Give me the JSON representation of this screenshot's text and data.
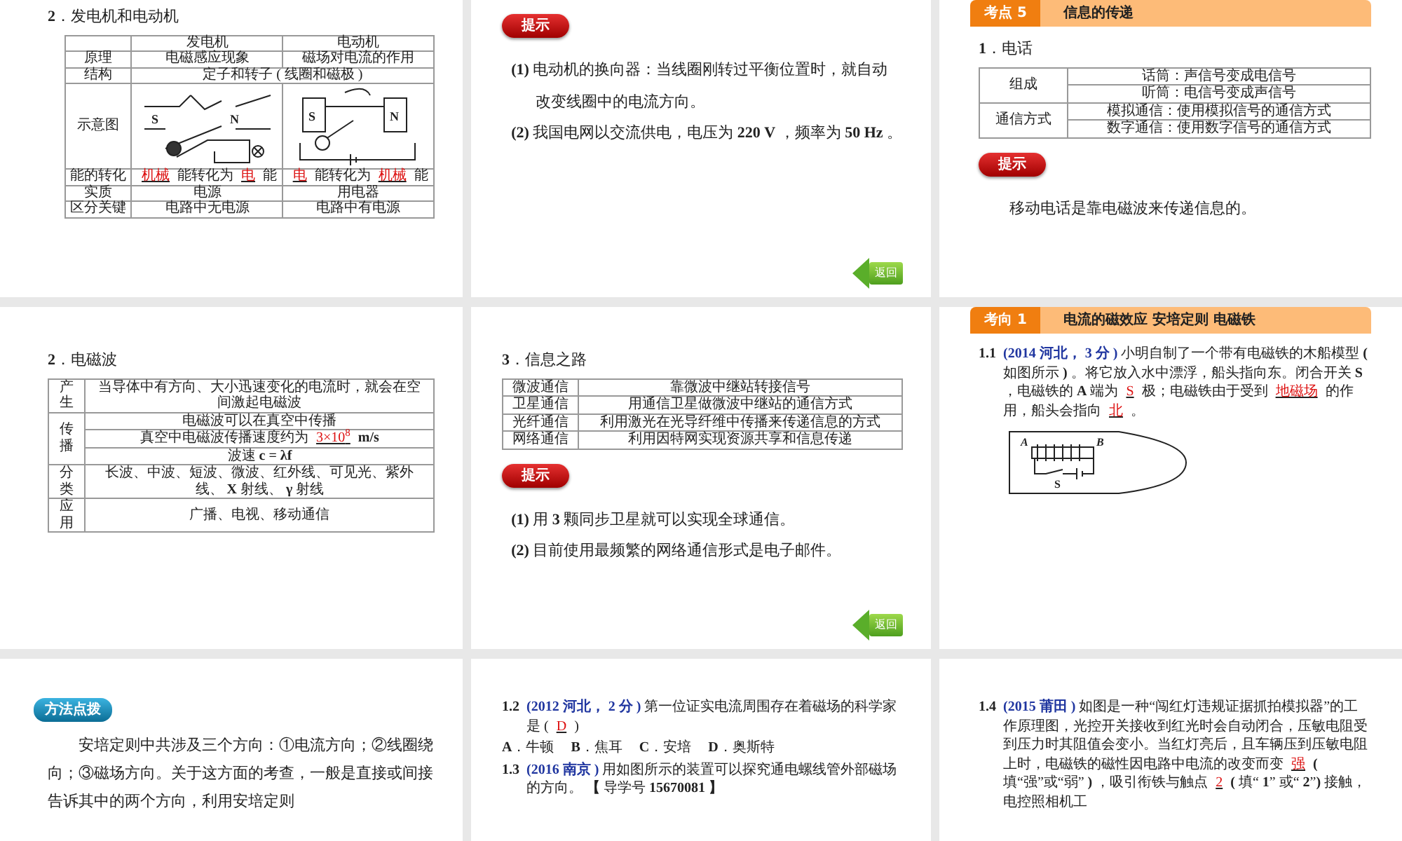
{
  "slides": [
    {
      "blocks": [
        {
          "kind": "heading",
          "text": "**2**．发电机和电动机"
        },
        {
          "kind": "table",
          "rows": [
            [
              {
                "text": ""
              },
              {
                "text": "发电机"
              },
              {
                "text": "电动机"
              }
            ],
            [
              {
                "text": "原理"
              },
              {
                "text": "电磁感应现象"
              },
              {
                "text": "磁场对电流的作用"
              }
            ],
            [
              {
                "text": "结构"
              },
              {
                "text": "定子和转子 ( 线圈和磁极 )",
                "colspan": 2
              }
            ],
            [
              {
                "text": "示意图"
              },
              {
                "kind": "diagram",
                "labels": [
                  "S",
                  "N"
                ]
              },
              {
                "kind": "diagram",
                "labels": [
                  "S",
                  "N"
                ]
              }
            ],
            [
              {
                "text": "能的转化"
              },
              {
                "parts": [
                  {
                    "kind": "answer",
                    "text": "机械"
                  },
                  {
                    "kind": "text",
                    "text": " 能转化为 "
                  },
                  {
                    "kind": "answer",
                    "text": "电"
                  },
                  {
                    "kind": "text",
                    "text": " 能"
                  }
                ]
              },
              {
                "parts": [
                  {
                    "kind": "answer",
                    "text": "电"
                  },
                  {
                    "kind": "text",
                    "text": " 能转化为 "
                  },
                  {
                    "kind": "answer",
                    "text": "机械"
                  },
                  {
                    "kind": "text",
                    "text": " 能"
                  }
                ]
              }
            ],
            [
              {
                "text": "实质"
              },
              {
                "text": "电源"
              },
              {
                "text": "用电器"
              }
            ],
            [
              {
                "text": "区分关键"
              },
              {
                "text": "电路中无电源"
              },
              {
                "text": "电路中有电源"
              }
            ]
          ]
        }
      ]
    },
    {
      "blocks": [
        {
          "kind": "hint",
          "text": "提示"
        },
        {
          "kind": "paragraphs",
          "items": [
            "**(1)** 电动机的换向器：当线圈刚转过平衡位置时，就自动改变线圈中的电流方向。",
            "**(2)** 我国电网以交流供电，电压为 **220 V** ，频率为 **50 Hz** 。"
          ]
        },
        {
          "kind": "back",
          "text": "返回"
        }
      ]
    },
    {
      "blocks": [
        {
          "kind": "banner",
          "label": "考点 5",
          "title": "信息的传递"
        },
        {
          "kind": "heading",
          "text": "**1**．电话"
        },
        {
          "kind": "table",
          "rows": [
            [
              {
                "text": "组成",
                "rowspan": 2
              },
              {
                "text": "话筒：声信号变成电信号"
              }
            ],
            [
              {
                "text": "听筒：电信号变成声信号"
              }
            ],
            [
              {
                "text": "通信方式",
                "rowspan": 2
              },
              {
                "text": "模拟通信：使用模拟信号的通信方式"
              }
            ],
            [
              {
                "text": "数字通信：使用数字信号的通信方式"
              }
            ]
          ]
        },
        {
          "kind": "hint",
          "text": "提示"
        },
        {
          "kind": "note",
          "items": [
            "移动电话是靠电磁波来传递信息的。"
          ]
        }
      ]
    },
    {
      "blocks": [
        {
          "kind": "heading",
          "text": "**2**．电磁波"
        },
        {
          "kind": "table",
          "rows": [
            [
              {
                "text": "产生"
              },
              {
                "text": "当导体中有方向、大小迅速变化的电流时，就会在空间激起电磁波"
              }
            ],
            [
              {
                "text": "传播",
                "rowspan": 3
              },
              {
                "text": "电磁波可以在真空中传播"
              }
            ],
            [
              {
                "parts": [
                  {
                    "kind": "text",
                    "text": "真空中电磁波传播速度约为 "
                  },
                  {
                    "kind": "answer",
                    "text": "3×10$^{8}$"
                  },
                  {
                    "kind": "text",
                    "text": " **m/s**"
                  }
                ]
              }
            ],
            [
              {
                "text": "波速 **c = λf**"
              }
            ],
            [
              {
                "text": "分类"
              },
              {
                "text": "长波、中波、短波、微波、红外线、可见光、紫外线、 **X** 射线、 **γ** 射线"
              }
            ],
            [
              {
                "text": "应用"
              },
              {
                "text": "广播、电视、移动通信"
              }
            ]
          ]
        }
      ]
    },
    {
      "blocks": [
        {
          "kind": "heading",
          "text": "**3**．信息之路"
        },
        {
          "kind": "table",
          "rows": [
            [
              {
                "text": "微波通信"
              },
              {
                "text": "靠微波中继站转接信号"
              }
            ],
            [
              {
                "text": "卫星通信"
              },
              {
                "text": "用通信卫星做微波中继站的通信方式"
              }
            ],
            [
              {
                "text": "光纤通信"
              },
              {
                "text": "利用激光在光导纤维中传播来传递信息的方式"
              }
            ],
            [
              {
                "text": "网络通信"
              },
              {
                "text": "利用因特网实现资源共享和信息传递"
              }
            ]
          ]
        },
        {
          "kind": "hint",
          "text": "提示"
        },
        {
          "kind": "paragraphs",
          "items": [
            "**(1)** 用 **3** 颗同步卫星就可以实现全球通信。",
            "**(2)** 目前使用最频繁的网络通信形式是电子邮件。"
          ]
        },
        {
          "kind": "back",
          "text": "返回"
        }
      ]
    },
    {
      "blocks": [
        {
          "kind": "banner",
          "label": "考向 1",
          "title": "电流的磁效应  安培定则  电磁铁"
        },
        {
          "kind": "question",
          "number": "1.1",
          "source": "(2014 河北， 3 分 )",
          "body": [
            {
              "kind": "text",
              "text": "小明自制了一个带有电磁铁的木船模型 **(** 如图所示 **)** 。将它放入水中漂浮，船头指向东。闭合开关 **S** ，电磁铁的 **A** 端为 "
            },
            {
              "kind": "answer",
              "text": "S"
            },
            {
              "kind": "text",
              "text": " 极；电磁铁由于受到 "
            },
            {
              "kind": "answer",
              "text": "地磁场"
            },
            {
              "kind": "text",
              "text": " 的作用，船头会指向 "
            },
            {
              "kind": "answer",
              "text": "北"
            },
            {
              "kind": "text",
              "text": " 。"
            }
          ]
        },
        {
          "kind": "figure",
          "labels": [
            "A",
            "B",
            "S"
          ]
        }
      ]
    },
    {
      "blocks": [
        {
          "kind": "method",
          "text": "方法点拨"
        },
        {
          "kind": "note",
          "items": [
            "安培定则中共涉及三个方向：①电流方向；②线圈绕向；③磁场方向。关于这方面的考查，一般是直接或间接告诉其中的两个方向，利用安培定则"
          ]
        }
      ]
    },
    {
      "blocks": [
        {
          "kind": "question",
          "number": "1.2",
          "source": "(2012 河北， 2 分 )",
          "body": [
            {
              "kind": "text",
              "text": "第一位证实电流周围存在着磁场的科学家是 ( "
            },
            {
              "kind": "answer",
              "text": "D"
            },
            {
              "kind": "text",
              "text": " )"
            }
          ]
        },
        {
          "kind": "options",
          "items": [
            "**A**．牛顿",
            "**B**．焦耳",
            "**C**．安培",
            "**D**．奥斯特"
          ]
        },
        {
          "kind": "question",
          "number": "1.3",
          "source": "(2016 南京 )",
          "body": [
            {
              "kind": "text",
              "text": "用如图所示的装置可以探究通电螺线管外部磁场的方向。 **【** 导学号 **15670081 】**"
            }
          ]
        }
      ]
    },
    {
      "blocks": [
        {
          "kind": "question",
          "number": "1.4",
          "source": "(2015 莆田 )",
          "body": [
            {
              "kind": "text",
              "text": "如图是一种“闯红灯违规证据抓拍模拟器”的工作原理图，光控开关接收到红光时会自动闭合，压敏电阻受到压力时其阻值会变小。当红灯亮后，且车辆压到压敏电阻上时，电磁铁的磁性因电路中电流的改变而变 "
            },
            {
              "kind": "answer",
              "text": "强"
            },
            {
              "kind": "text",
              "text": " **(** 填“强”或“弱” **)** ，吸引衔铁与触点 "
            },
            {
              "kind": "answer",
              "text": "2"
            },
            {
              "kind": "text",
              "text": " **(** 填“ **1**” 或“ **2**”**)** 接触，电控照相机工"
            }
          ]
        }
      ]
    }
  ]
}
